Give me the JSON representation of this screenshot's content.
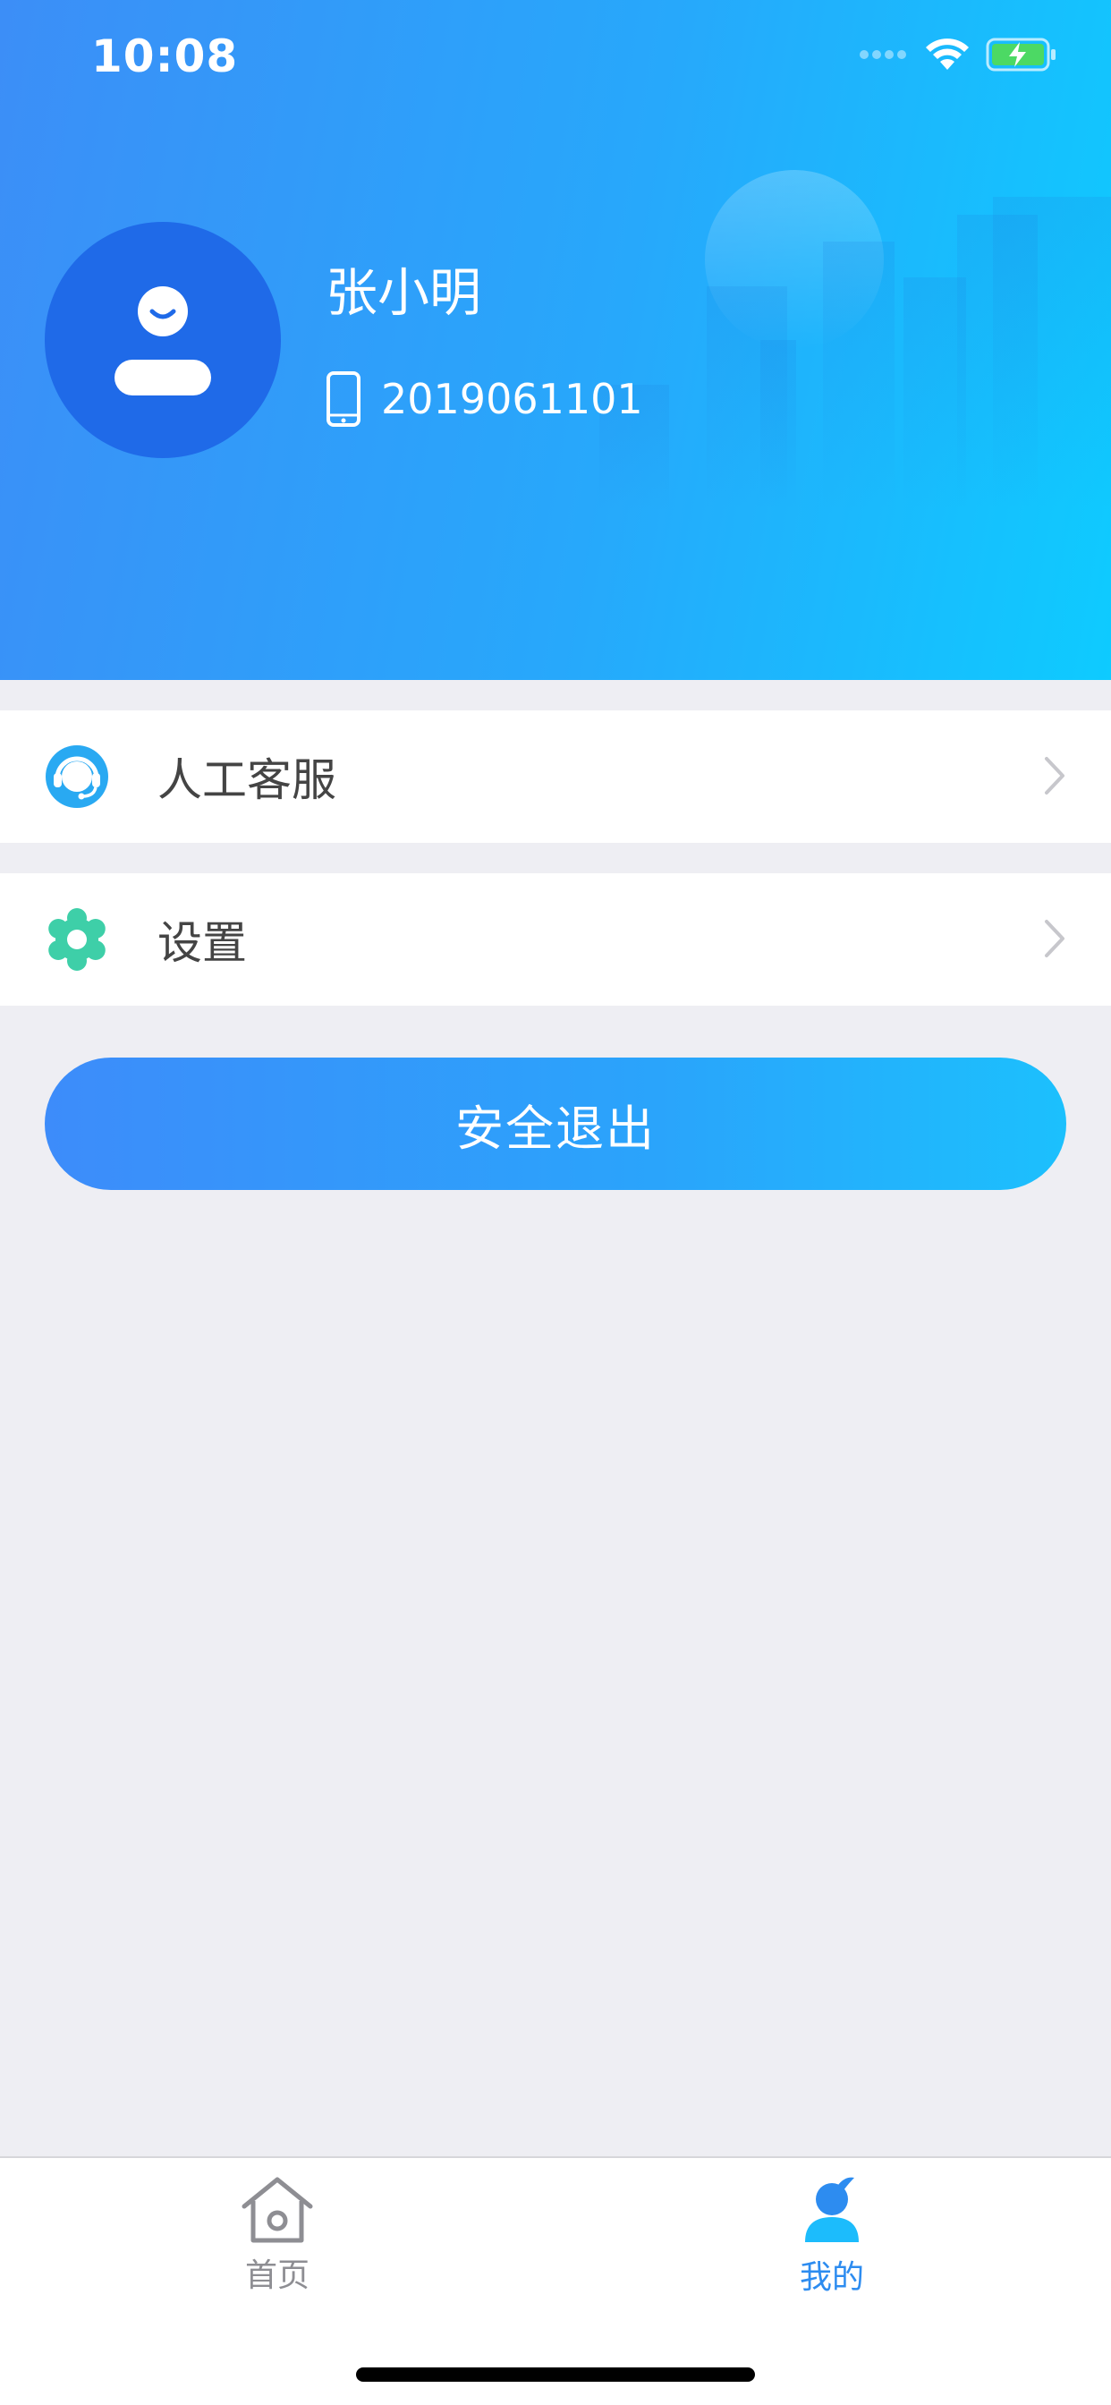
{
  "status_bar": {
    "time": "10:08",
    "icons": [
      "signal-icon",
      "wifi-icon",
      "battery-charging-icon"
    ]
  },
  "profile": {
    "name": "张小明",
    "phone": "2019061101",
    "avatar_icon": "user-avatar-icon",
    "phone_icon": "mobile-phone-icon"
  },
  "menu": {
    "items": [
      {
        "label": "人工客服",
        "icon": "headset-icon"
      },
      {
        "label": "设置",
        "icon": "gear-icon"
      }
    ]
  },
  "logout": {
    "label": "安全退出"
  },
  "tabbar": {
    "tabs": [
      {
        "label": "首页",
        "icon": "home-icon",
        "active": false
      },
      {
        "label": "我的",
        "icon": "person-icon",
        "active": true
      }
    ]
  },
  "colors": {
    "header_start": "#3c8ef7",
    "header_end": "#0ecbff",
    "avatar_bg": "#1f6ae8",
    "headset": "#29a9f2",
    "gear": "#3ecfa8",
    "active_tab": "#2d8cf0",
    "inactive_tab": "#8e8e93",
    "page_bg": "#eeeef3"
  }
}
